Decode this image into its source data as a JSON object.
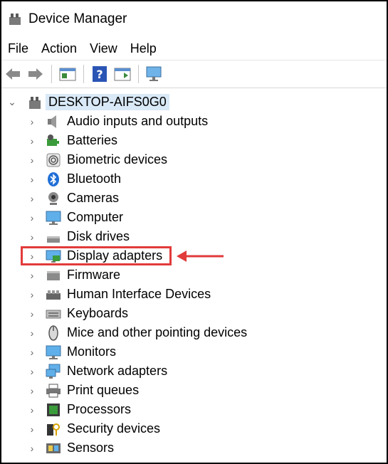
{
  "window": {
    "title": "Device Manager"
  },
  "menu": [
    "File",
    "Action",
    "View",
    "Help"
  ],
  "toolbar": {
    "icons": [
      "back-arrow-icon",
      "forward-arrow-icon",
      "properties-icon",
      "help-icon",
      "run-icon",
      "monitor-scan-icon"
    ]
  },
  "tree": {
    "root": "DESKTOP-AIFS0G0",
    "items": [
      {
        "label": "Audio inputs and outputs",
        "icon": "speaker-icon"
      },
      {
        "label": "Batteries",
        "icon": "battery-icon"
      },
      {
        "label": "Biometric devices",
        "icon": "fingerprint-icon"
      },
      {
        "label": "Bluetooth",
        "icon": "bluetooth-icon"
      },
      {
        "label": "Cameras",
        "icon": "camera-icon"
      },
      {
        "label": "Computer",
        "icon": "computer-icon"
      },
      {
        "label": "Disk drives",
        "icon": "disk-drive-icon"
      },
      {
        "label": "Display adapters",
        "icon": "display-adapter-icon"
      },
      {
        "label": "Firmware",
        "icon": "firmware-icon"
      },
      {
        "label": "Human Interface Devices",
        "icon": "hid-icon"
      },
      {
        "label": "Keyboards",
        "icon": "keyboard-icon"
      },
      {
        "label": "Mice and other pointing devices",
        "icon": "mouse-icon"
      },
      {
        "label": "Monitors",
        "icon": "monitor-icon"
      },
      {
        "label": "Network adapters",
        "icon": "network-icon"
      },
      {
        "label": "Print queues",
        "icon": "printer-icon"
      },
      {
        "label": "Processors",
        "icon": "processor-icon"
      },
      {
        "label": "Security devices",
        "icon": "security-icon"
      },
      {
        "label": "Sensors",
        "icon": "sensor-icon"
      }
    ],
    "highlighted": "Display adapters"
  },
  "colors": {
    "highlight": "#e23b3b",
    "selection": "#d9e9f7"
  }
}
